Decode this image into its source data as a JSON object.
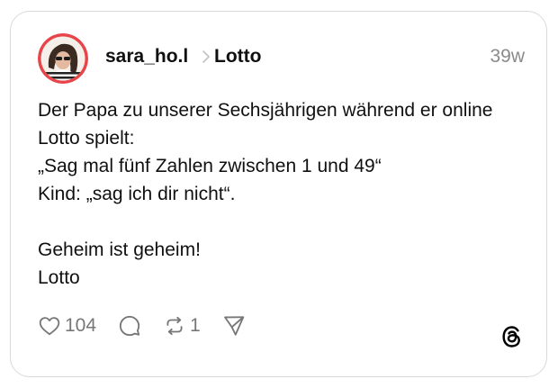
{
  "post": {
    "username": "sara_ho.l",
    "topic": "Lotto",
    "time": "39w",
    "body_lines": [
      "Der Papa zu unserer Sechsjährigen während er online",
      "Lotto spielt:",
      "„Sag mal fünf Zahlen zwischen 1 und 49“",
      "Kind: „sag ich dir nicht“.",
      "",
      "Geheim ist geheim!",
      "Lotto"
    ],
    "actions": {
      "likes": "104",
      "reposts": "1"
    }
  },
  "icons": {
    "like": "heart-icon",
    "comment": "comment-icon",
    "repost": "repost-icon",
    "share": "share-icon",
    "brand": "threads-logo-icon"
  },
  "colors": {
    "text": "#101010",
    "muted": "#8a8a8a",
    "border": "#d9d9d9",
    "avatar_ring": "#e8454a"
  }
}
